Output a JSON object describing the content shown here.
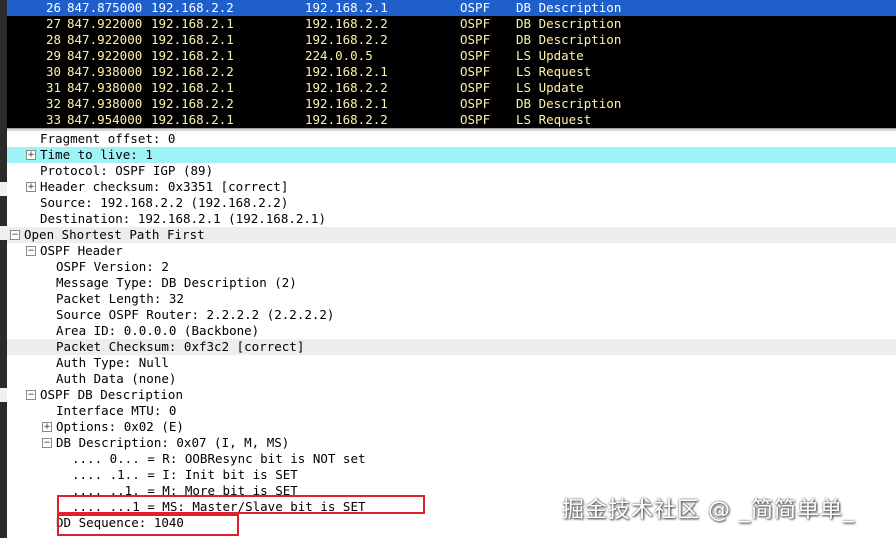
{
  "packets": [
    {
      "no": "26",
      "time": "847.875000",
      "src": "192.168.2.2",
      "dst": "192.168.2.1",
      "proto": "OSPF",
      "info": "DB Description",
      "selected": true
    },
    {
      "no": "27",
      "time": "847.922000",
      "src": "192.168.2.1",
      "dst": "192.168.2.2",
      "proto": "OSPF",
      "info": "DB Description",
      "selected": false
    },
    {
      "no": "28",
      "time": "847.922000",
      "src": "192.168.2.1",
      "dst": "192.168.2.2",
      "proto": "OSPF",
      "info": "DB Description",
      "selected": false
    },
    {
      "no": "29",
      "time": "847.922000",
      "src": "192.168.2.1",
      "dst": "224.0.0.5",
      "proto": "OSPF",
      "info": "LS Update",
      "selected": false
    },
    {
      "no": "30",
      "time": "847.938000",
      "src": "192.168.2.2",
      "dst": "192.168.2.1",
      "proto": "OSPF",
      "info": "LS Request",
      "selected": false
    },
    {
      "no": "31",
      "time": "847.938000",
      "src": "192.168.2.1",
      "dst": "192.168.2.2",
      "proto": "OSPF",
      "info": "LS Update",
      "selected": false
    },
    {
      "no": "32",
      "time": "847.938000",
      "src": "192.168.2.2",
      "dst": "192.168.2.1",
      "proto": "OSPF",
      "info": "DB Description",
      "selected": false
    },
    {
      "no": "33",
      "time": "847.954000",
      "src": "192.168.2.1",
      "dst": "192.168.2.2",
      "proto": "OSPF",
      "info": "LS Request",
      "selected": false
    }
  ],
  "details": [
    {
      "text": "Fragment offset: 0",
      "indent": 2,
      "toggle": "",
      "style": ""
    },
    {
      "text": "Time to live: 1",
      "indent": 2,
      "toggle": "+",
      "style": "hl"
    },
    {
      "text": "Protocol: OSPF IGP (89)",
      "indent": 2,
      "toggle": "",
      "style": ""
    },
    {
      "text": "Header checksum: 0x3351 [correct]",
      "indent": 2,
      "toggle": "+",
      "style": ""
    },
    {
      "text": "Source: 192.168.2.2 (192.168.2.2)",
      "indent": 2,
      "toggle": "",
      "style": ""
    },
    {
      "text": "Destination: 192.168.2.1 (192.168.2.1)",
      "indent": 2,
      "toggle": "",
      "style": ""
    },
    {
      "text": "Open Shortest Path First",
      "indent": 1,
      "toggle": "-",
      "style": "shade"
    },
    {
      "text": "OSPF Header",
      "indent": 2,
      "toggle": "-",
      "style": ""
    },
    {
      "text": "OSPF Version: 2",
      "indent": 3,
      "toggle": "",
      "style": ""
    },
    {
      "text": "Message Type: DB Description (2)",
      "indent": 3,
      "toggle": "",
      "style": ""
    },
    {
      "text": "Packet Length: 32",
      "indent": 3,
      "toggle": "",
      "style": ""
    },
    {
      "text": "Source OSPF Router: 2.2.2.2 (2.2.2.2)",
      "indent": 3,
      "toggle": "",
      "style": ""
    },
    {
      "text": "Area ID: 0.0.0.0 (Backbone)",
      "indent": 3,
      "toggle": "",
      "style": ""
    },
    {
      "text": "Packet Checksum: 0xf3c2 [correct]",
      "indent": 3,
      "toggle": "",
      "style": "shade"
    },
    {
      "text": "Auth Type: Null",
      "indent": 3,
      "toggle": "",
      "style": ""
    },
    {
      "text": "Auth Data (none)",
      "indent": 3,
      "toggle": "",
      "style": ""
    },
    {
      "text": "OSPF DB Description",
      "indent": 2,
      "toggle": "-",
      "style": ""
    },
    {
      "text": "Interface MTU: 0",
      "indent": 3,
      "toggle": "",
      "style": ""
    },
    {
      "text": "Options: 0x02 (E)",
      "indent": 3,
      "toggle": "+",
      "style": ""
    },
    {
      "text": "DB Description: 0x07 (I, M, MS)",
      "indent": 3,
      "toggle": "-",
      "style": ""
    },
    {
      "text": ".... 0... = R: OOBResync bit is NOT set",
      "indent": 4,
      "toggle": "",
      "style": ""
    },
    {
      "text": ".... .1.. = I: Init bit is SET",
      "indent": 4,
      "toggle": "",
      "style": ""
    },
    {
      "text": ".... ..1. = M: More bit is SET",
      "indent": 4,
      "toggle": "",
      "style": ""
    },
    {
      "text": ".... ...1 = MS: Master/Slave bit is SET",
      "indent": 4,
      "toggle": "",
      "style": ""
    },
    {
      "text": "DD Sequence: 1040",
      "indent": 3,
      "toggle": "",
      "style": ""
    }
  ],
  "watermark": "掘金技术社区 @ _简简单单_",
  "colors": {
    "packet_bg": "#000000",
    "packet_fg": "#fff2a8",
    "selected_bg": "#1f5fcc",
    "highlight_bg": "#9ff3f7",
    "annotation": "#e0212d"
  }
}
